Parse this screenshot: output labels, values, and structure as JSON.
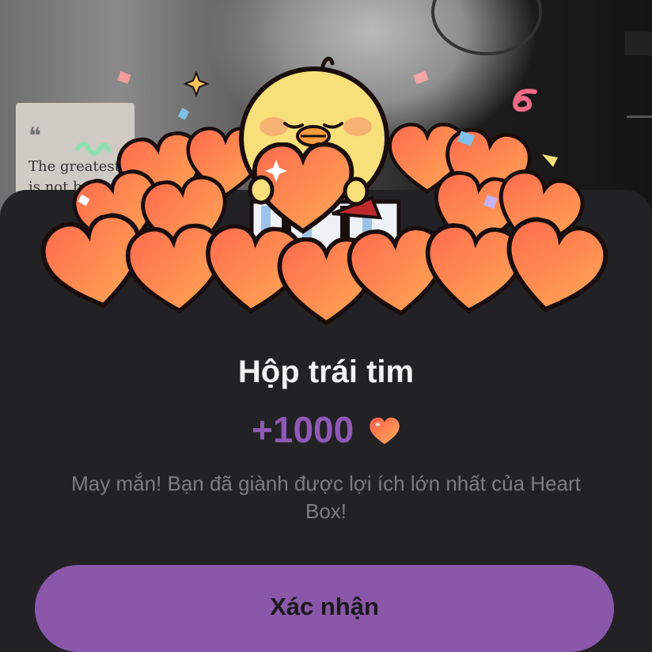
{
  "background": {
    "quote_mark": "❝",
    "quote_line_1": "The greatest",
    "quote_line_2": "is not b"
  },
  "dialog": {
    "title": "Hộp trái tim",
    "amount": "+1000",
    "reward_icon": "heart-icon",
    "message": "May mắn! Bạn đã giành được lợi ích lớn nhất của Heart Box!",
    "confirm_label": "Xác nhận"
  },
  "colors": {
    "sheet_background": "#222224",
    "amount_purple": "#8f59b5",
    "button_purple": "#8a57ab",
    "heart_red": "#f0493a",
    "chick_yellow": "#f7df7a"
  }
}
